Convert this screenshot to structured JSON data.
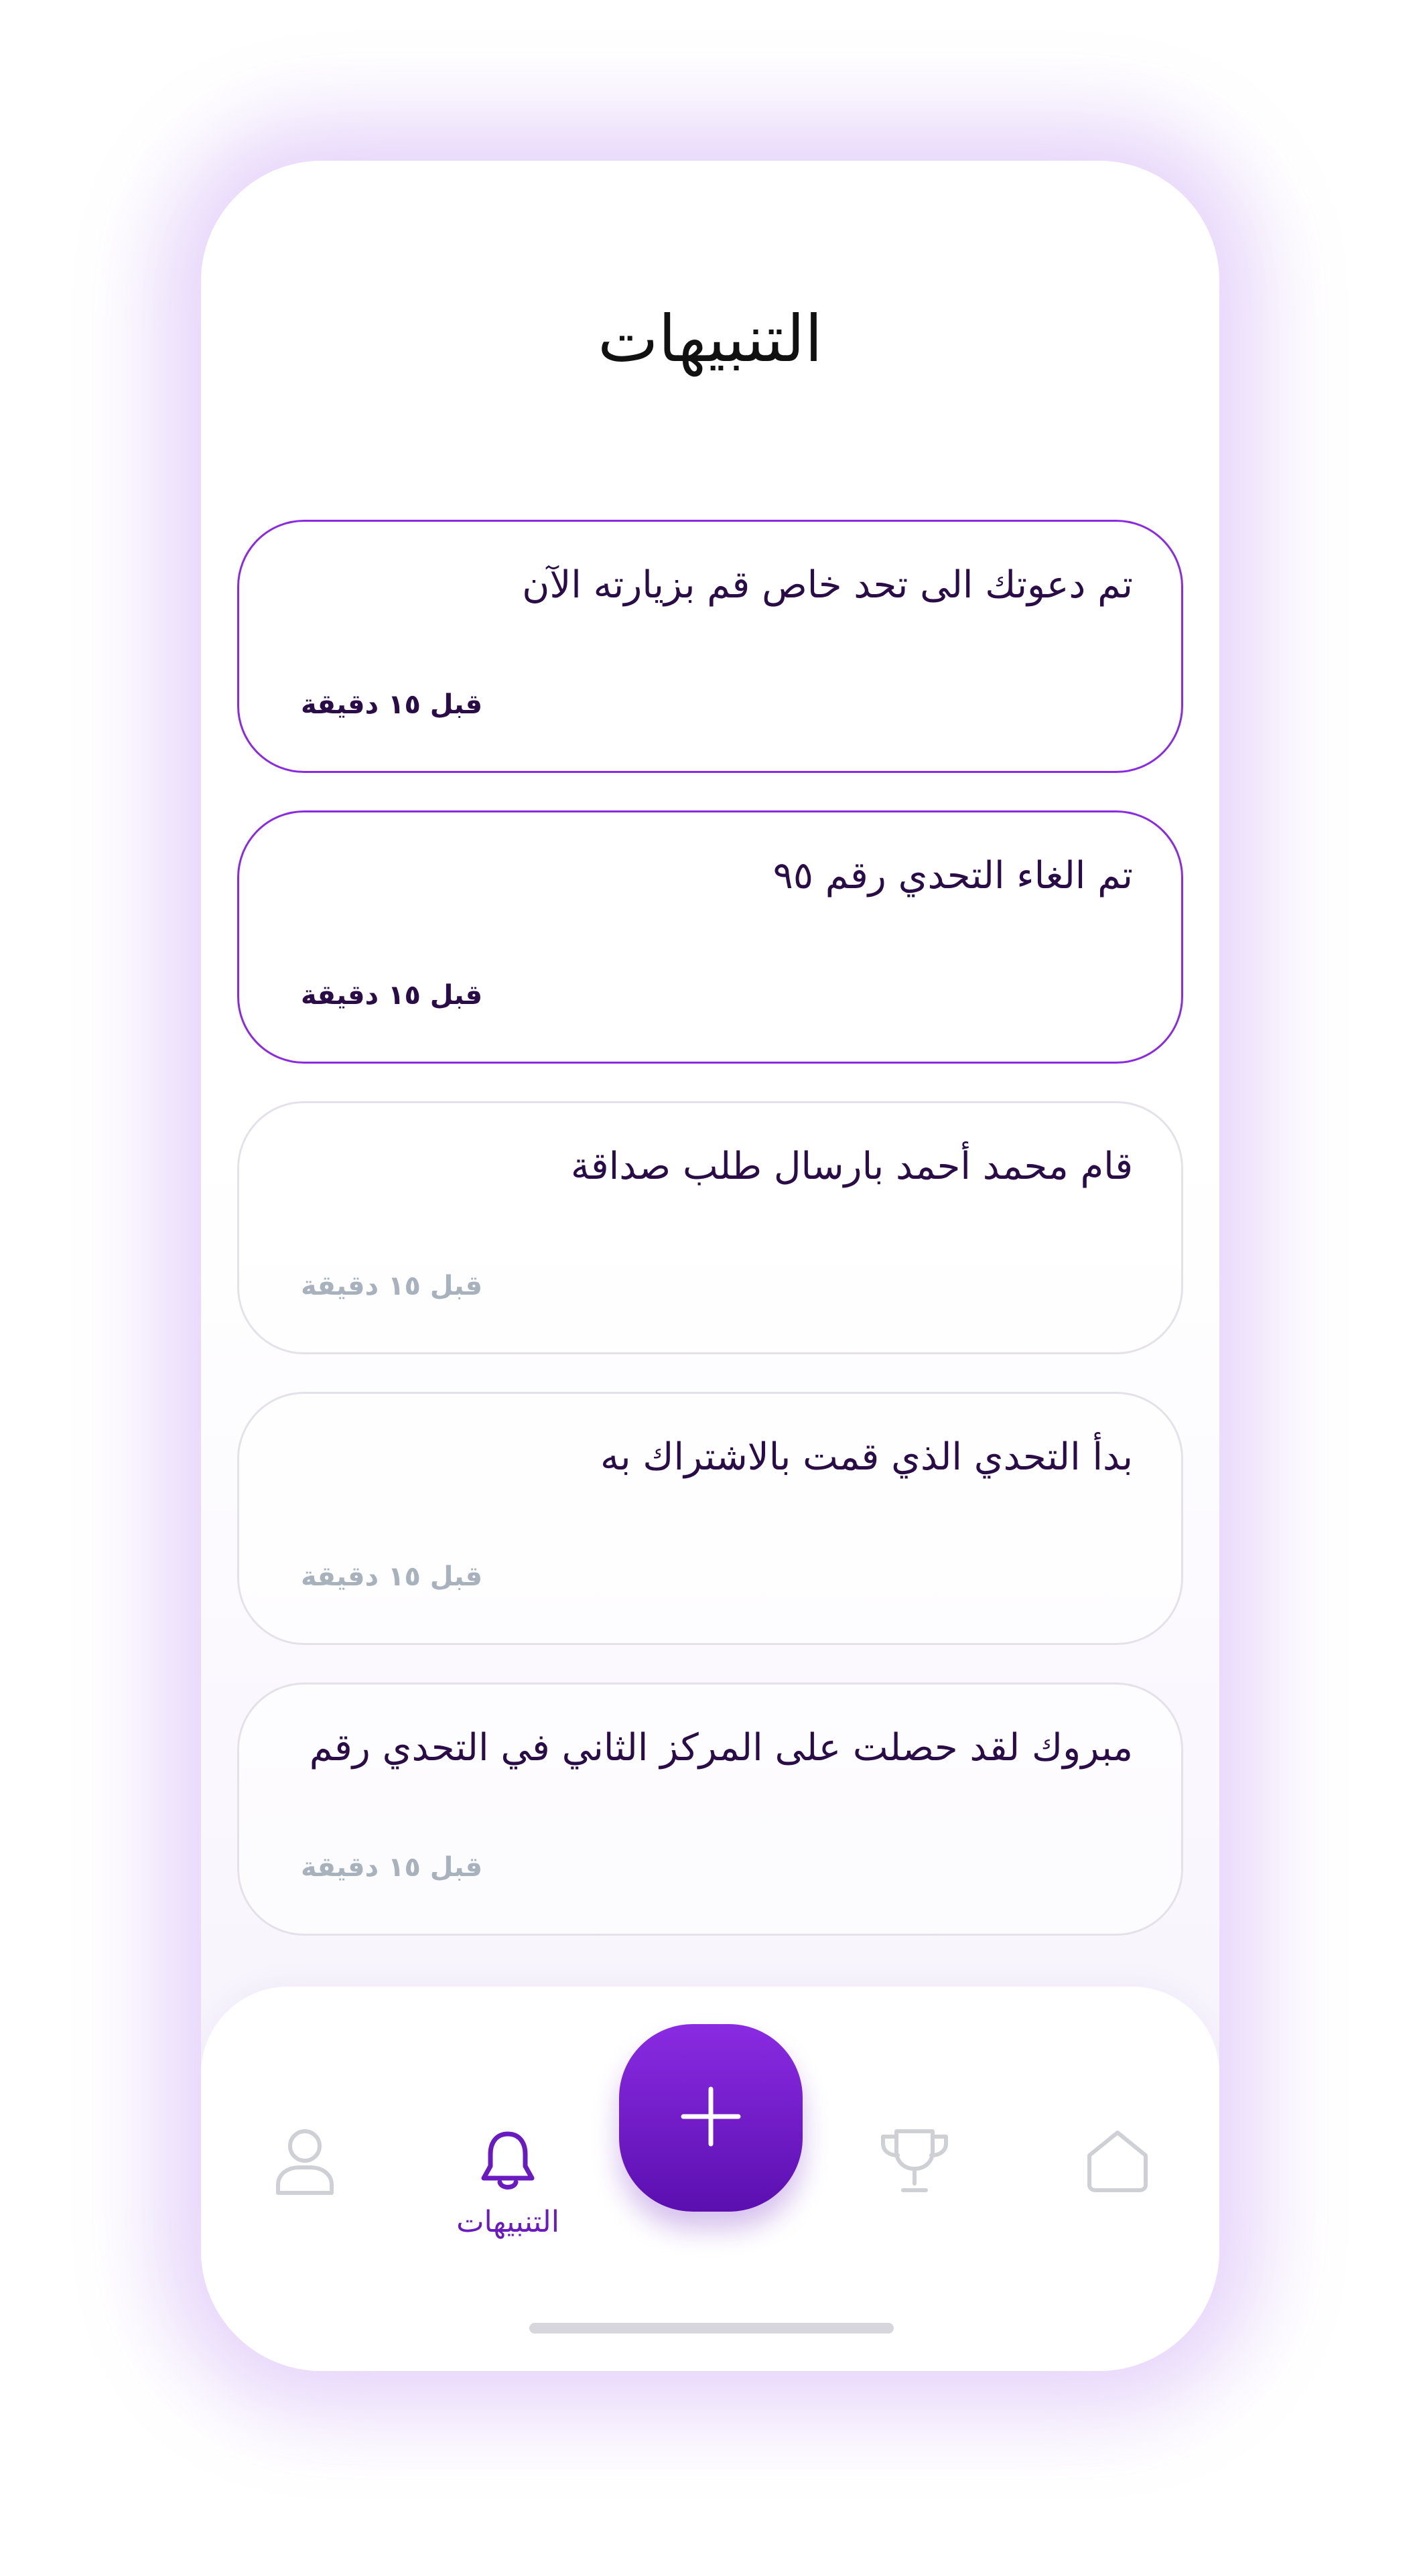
{
  "header": {
    "title": "التنبيهات"
  },
  "notifications": [
    {
      "text": "تم دعوتك الى تحد خاص قم بزيارته الآن",
      "time": "قبل ١٥ دقيقة",
      "unread": true
    },
    {
      "text": "تم الغاء التحدي رقم ٩٥",
      "time": "قبل ١٥ دقيقة",
      "unread": true
    },
    {
      "text": "قام محمد أحمد بارسال طلب صداقة",
      "time": "قبل ١٥ دقيقة",
      "unread": false
    },
    {
      "text": "بدأ التحدي الذي قمت بالاشتراك به",
      "time": "قبل ١٥ دقيقة",
      "unread": false
    },
    {
      "text": "مبروك لقد حصلت على المركز الثاني في التحدي رقم",
      "time": "قبل ١٥ دقيقة",
      "unread": false
    }
  ],
  "bottom_nav": {
    "active_label": "التنبيهات",
    "items": [
      {
        "icon": "home-icon",
        "active": false
      },
      {
        "icon": "trophy-icon",
        "active": false
      },
      {
        "icon": "plus-icon",
        "active": false
      },
      {
        "icon": "bell-icon",
        "active": true
      },
      {
        "icon": "user-icon",
        "active": false
      }
    ]
  },
  "colors": {
    "accent": "#8a2be2",
    "accent_dark": "#5b0fb0",
    "text_dark": "#2a0d47",
    "muted": "#a8b2bd",
    "inactive_icon": "#cfcfd6"
  }
}
